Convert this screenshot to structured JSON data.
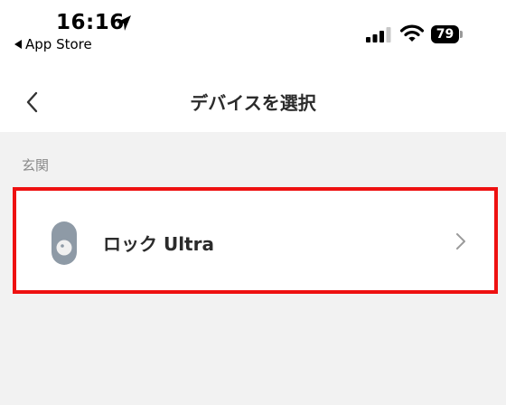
{
  "status_bar": {
    "time": "16:16",
    "back_app_label": "App Store",
    "battery_level": "79"
  },
  "nav": {
    "title": "デバイスを選択"
  },
  "section": {
    "label": "玄関"
  },
  "devices": [
    {
      "name": "ロック Ultra",
      "icon": "smart-lock-icon"
    }
  ],
  "colors": {
    "highlight": "#ee1111",
    "background": "#f2f2f2",
    "text_primary": "#2b2b2b",
    "text_secondary": "#8a8a8a"
  }
}
